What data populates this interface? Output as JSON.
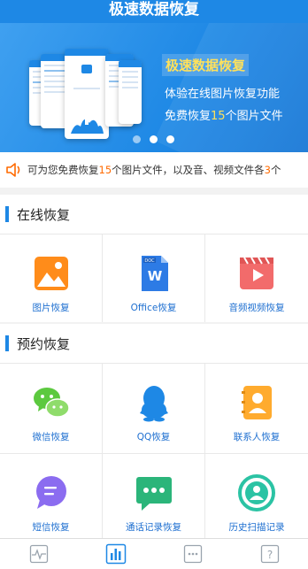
{
  "header": {
    "title": "极速数据恢复"
  },
  "banner": {
    "title": "极速数据恢复",
    "line1": "体验在线图片恢复功能",
    "line2_prefix": "免费恢复",
    "line2_num": "15",
    "line2_suffix": "个图片文件",
    "active_dot": 1,
    "dot_count": 3
  },
  "notice": {
    "prefix": "可为您免费恢复",
    "num1": "15",
    "middle": "个图片文件，以及音、视频文件各",
    "num2": "3",
    "suffix": "个"
  },
  "online": {
    "title": "在线恢复",
    "items": [
      {
        "label": "图片恢复",
        "icon": "image-icon"
      },
      {
        "label": "Office恢复",
        "icon": "word-doc-icon",
        "icon_text": "W",
        "icon_tag": "DOC"
      },
      {
        "label": "音频视频恢复",
        "icon": "video-icon"
      }
    ]
  },
  "reserve": {
    "title": "预约恢复",
    "items": [
      {
        "label": "微信恢复",
        "icon": "wechat-icon"
      },
      {
        "label": "QQ恢复",
        "icon": "qq-icon"
      },
      {
        "label": "联系人恢复",
        "icon": "contacts-icon"
      },
      {
        "label": "短信恢复",
        "icon": "sms-icon"
      },
      {
        "label": "通话记录恢复",
        "icon": "call-log-icon"
      },
      {
        "label": "历史扫描记录",
        "icon": "scan-history-icon"
      }
    ]
  },
  "tabbar": {
    "items": [
      {
        "icon": "pulse-icon",
        "active": false
      },
      {
        "icon": "chart-icon",
        "active": true
      },
      {
        "icon": "more-icon",
        "active": false
      },
      {
        "icon": "help-icon",
        "active": false,
        "text": "?"
      }
    ]
  },
  "colors": {
    "primary": "#1e88e5",
    "highlight": "#ffe15b",
    "accent": "#ff6a00"
  }
}
